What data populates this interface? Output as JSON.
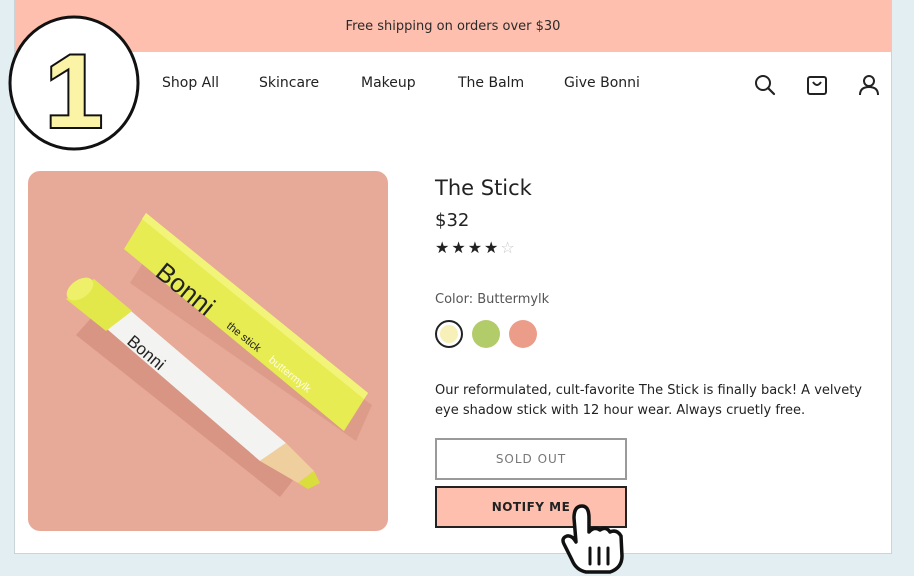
{
  "banner": {
    "text": "Free shipping on orders over $30"
  },
  "step": {
    "number": "1"
  },
  "nav": {
    "items": [
      "Shop All",
      "Skincare",
      "Makeup",
      "The Balm",
      "Give Bonni"
    ]
  },
  "header_icons": [
    "search-icon",
    "bag-icon",
    "account-icon"
  ],
  "product": {
    "title": "The Stick",
    "price": "$32",
    "rating": 4,
    "rating_max": 5,
    "color_label": "Color: Buttermylk",
    "swatches": [
      {
        "name": "Buttermylk",
        "color": "#f7f0b8",
        "selected": true
      },
      {
        "name": "green",
        "color": "#b3cc6a",
        "selected": false
      },
      {
        "name": "pink",
        "color": "#ec9d8a",
        "selected": false
      }
    ],
    "description": "Our reformulated, cult-favorite The Stick is finally back! A velvety eye shadow stick with 12 hour wear. Always cruetly free.",
    "image_brand": "Bonni",
    "image_product": "the stick",
    "image_shade": "buttermylk"
  },
  "buttons": {
    "sold_out": "SOLD OUT",
    "notify": "NOTIFY ME"
  },
  "colors": {
    "accent": "#ffbfae",
    "background": "#e3eef3",
    "image_bg": "#e8aa98",
    "stick_yellow": "#e6ea4f"
  }
}
